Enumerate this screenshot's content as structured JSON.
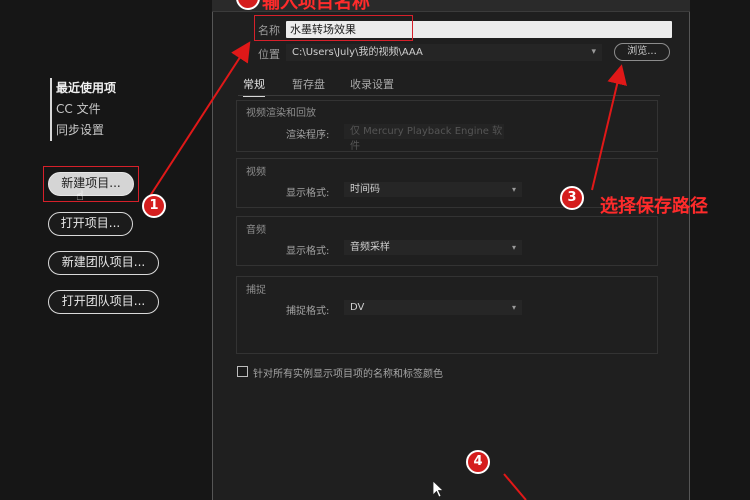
{
  "left_panel": {
    "recent": [
      "最近使用项",
      "CC 文件",
      "同步设置"
    ],
    "buttons": [
      "新建项目...",
      "打开项目...",
      "新建团队项目...",
      "打开团队项目..."
    ]
  },
  "dialog": {
    "name_label": "名称",
    "name_value": "水墨转场效果",
    "location_label": "位置",
    "location_value": "C:\\Users\\July\\我的视频\\AAA",
    "browse_label": "浏览...",
    "tabs": [
      "常规",
      "暂存盘",
      "收录设置"
    ],
    "render_group": {
      "title": "视频渲染和回放",
      "renderer_label": "渲染程序:",
      "renderer_value": "仅 Mercury Playback Engine 软件"
    },
    "video_group": {
      "title": "视频",
      "format_label": "显示格式:",
      "format_value": "时间码"
    },
    "audio_group": {
      "title": "音频",
      "format_label": "显示格式:",
      "format_value": "音频采样"
    },
    "capture_group": {
      "title": "捕捉",
      "format_label": "捕捉格式:",
      "format_value": "DV"
    },
    "checkbox_label": "针对所有实例显示项目项的名称和标签颜色"
  },
  "annotations": {
    "badges": [
      "1",
      "3",
      "4"
    ],
    "step1_text": "输入项目名称",
    "step3_text": "选择保存路径",
    "annotation_color": "#ff2b2b"
  }
}
